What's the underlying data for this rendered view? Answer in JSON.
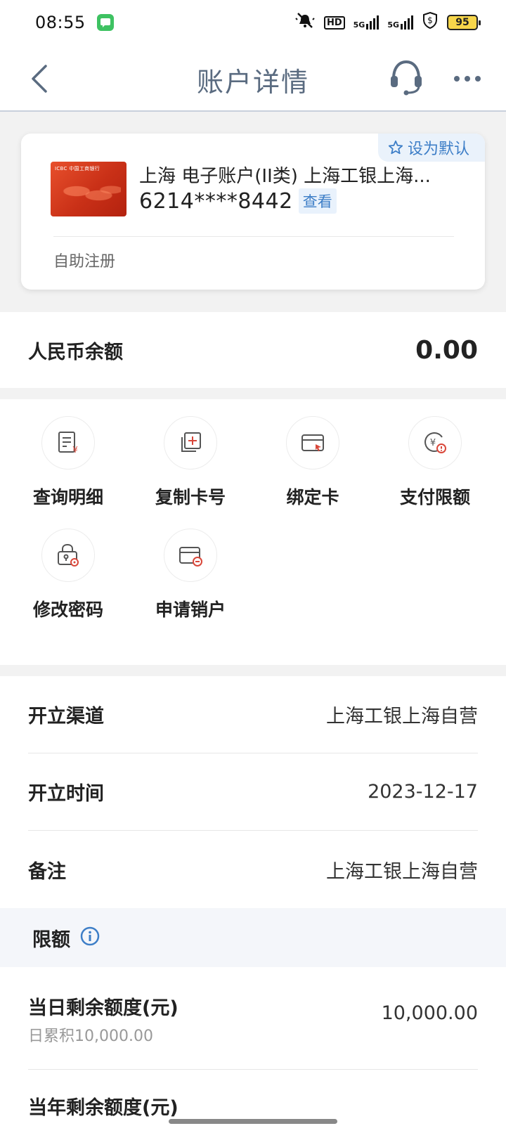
{
  "status_bar": {
    "time": "08:55",
    "hd_label": "HD",
    "net1": "5G",
    "net2": "5G",
    "battery": "95"
  },
  "header": {
    "title": "账户详情"
  },
  "card": {
    "default_label": "设为默认",
    "bank_logo_text": "ICBC 中国工商银行",
    "account_name": "上海 电子账户(II类) 上海工银上海...",
    "card_number": "6214****8442",
    "view_label": "查看",
    "footer": "自助注册"
  },
  "balance": {
    "label": "人民币余额",
    "value": "0.00"
  },
  "functions": [
    {
      "label": "查询明细",
      "icon": "statement-icon"
    },
    {
      "label": "复制卡号",
      "icon": "copy-icon"
    },
    {
      "label": "绑定卡",
      "icon": "bind-card-icon"
    },
    {
      "label": "支付限额",
      "icon": "payment-limit-icon"
    },
    {
      "label": "修改密码",
      "icon": "password-icon"
    },
    {
      "label": "申请销户",
      "icon": "close-account-icon"
    }
  ],
  "info": [
    {
      "label": "开立渠道",
      "value": "上海工银上海自营"
    },
    {
      "label": "开立时间",
      "value": "2023-12-17"
    },
    {
      "label": "备注",
      "value": "上海工银上海自营"
    }
  ],
  "limits": {
    "title": "限额",
    "daily": {
      "label": "当日剩余额度(元)",
      "sub": "日累积10,000.00",
      "value": "10,000.00"
    },
    "yearly": {
      "label": "当年剩余额度(元)"
    }
  },
  "colors": {
    "accent": "#3d7ec7",
    "title": "#5a6b80",
    "icon_red": "#d9473a"
  }
}
